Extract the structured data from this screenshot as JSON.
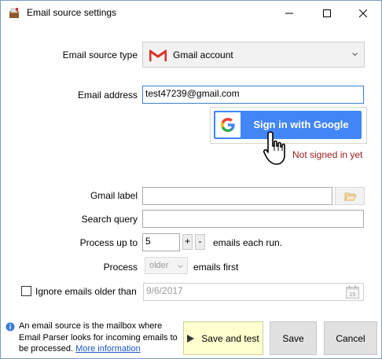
{
  "window": {
    "title": "Email source settings",
    "buttons": {
      "minimize": "minimize-icon",
      "maximize": "maximize-icon",
      "close": "close-icon"
    }
  },
  "form": {
    "source_type_label": "Email source type",
    "source_type_value": "Gmail account",
    "email_label": "Email address",
    "email_value": "test47239@gmail.com",
    "google_button_label": "Sign in with Google",
    "signin_status": "Not signed in yet",
    "gmail_label_label": "Gmail label",
    "gmail_label_value": "",
    "search_query_label": "Search query",
    "search_query_value": "",
    "process_up_to_label": "Process up to",
    "process_up_to_value": "5",
    "plus_label": "+",
    "minus_label": "-",
    "emails_each_run": "emails each run.",
    "process_label": "Process",
    "process_order_value": "older",
    "emails_first": "emails first",
    "ignore_label": "Ignore emails older than",
    "ignore_checked": false,
    "ignore_date_value": "9/6/2017"
  },
  "footer": {
    "info_text": "An email source is the mailbox where Email Parser looks for incoming emails to be processed.",
    "info_link": "More information",
    "save_and_test_label": "Save and test",
    "save_label": "Save",
    "cancel_label": "Cancel"
  },
  "colors": {
    "google_blue": "#4285f4",
    "status_red": "#9b1c1c",
    "link_blue": "#1a56c9",
    "primary_button_bg": "#ffffcf"
  }
}
